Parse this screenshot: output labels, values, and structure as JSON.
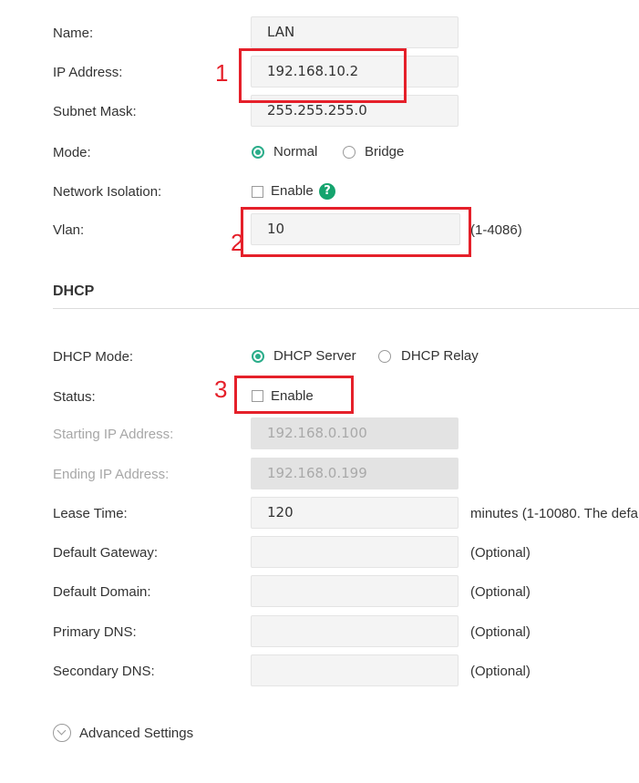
{
  "lan": {
    "name": {
      "label": "Name:",
      "value": "LAN"
    },
    "ip_address": {
      "label": "IP Address:",
      "value": "192.168.10.2"
    },
    "subnet_mask": {
      "label": "Subnet Mask:",
      "value": "255.255.255.0"
    },
    "mode": {
      "label": "Mode:",
      "options": [
        "Normal",
        "Bridge"
      ],
      "selected": "Normal"
    },
    "network_isolation": {
      "label": "Network Isolation:",
      "checkbox_label": "Enable",
      "checked": false,
      "help_icon": "?"
    },
    "vlan": {
      "label": "Vlan:",
      "value": "10",
      "range": "(1-4086)"
    }
  },
  "dhcp": {
    "section_title": "DHCP",
    "mode": {
      "label": "DHCP Mode:",
      "options": [
        "DHCP Server",
        "DHCP Relay"
      ],
      "selected": "DHCP Server"
    },
    "status": {
      "label": "Status:",
      "checkbox_label": "Enable",
      "checked": false
    },
    "starting_ip": {
      "label": "Starting IP Address:",
      "value": "192.168.0.100"
    },
    "ending_ip": {
      "label": "Ending IP Address:",
      "value": "192.168.0.199"
    },
    "lease_time": {
      "label": "Lease Time:",
      "value": "120",
      "hint": "minutes (1-10080. The defa"
    },
    "default_gateway": {
      "label": "Default Gateway:",
      "value": "",
      "hint": "(Optional)"
    },
    "default_domain": {
      "label": "Default Domain:",
      "value": "",
      "hint": "(Optional)"
    },
    "primary_dns": {
      "label": "Primary DNS:",
      "value": "",
      "hint": "(Optional)"
    },
    "secondary_dns": {
      "label": "Secondary DNS:",
      "value": "",
      "hint": "(Optional)"
    }
  },
  "advanced_settings": {
    "label": "Advanced Settings",
    "icon": "chevron-down-icon"
  },
  "annotations": {
    "one": "1",
    "two": "2",
    "three": "3",
    "color": "#e5202a"
  },
  "colors": {
    "accent": "#2bad8a",
    "help": "#15a46e"
  }
}
